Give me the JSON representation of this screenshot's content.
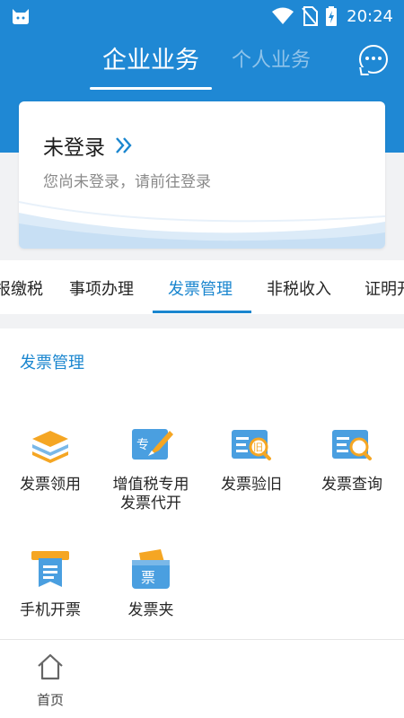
{
  "status_bar": {
    "time": "20:24",
    "icons": [
      "cat-app-icon",
      "wifi-icon",
      "no-sim-icon",
      "battery-charging-icon"
    ]
  },
  "header": {
    "tabs": [
      {
        "label": "企业业务",
        "active": true
      },
      {
        "label": "个人业务",
        "active": false
      }
    ],
    "chat_icon": "chat-bubble-icon",
    "background_color": "#1f88d4"
  },
  "login_card": {
    "title": "未登录",
    "subtitle": "您尚未登录，请前往登录",
    "arrow_icon": "double-chevron-right-icon"
  },
  "category_tabs": [
    {
      "label": "报缴税",
      "active": false
    },
    {
      "label": "事项办理",
      "active": false
    },
    {
      "label": "发票管理",
      "active": true
    },
    {
      "label": "非税收入",
      "active": false
    },
    {
      "label": "证明开",
      "active": false
    }
  ],
  "section": {
    "title": "发票管理",
    "items": [
      {
        "label": "发票领用",
        "icon": "layers-icon"
      },
      {
        "label_line1": "增值税专用",
        "label_line2": "发票代开",
        "icon": "special-invoice-pen-icon",
        "icon_text": "专"
      },
      {
        "label": "发票验旧",
        "icon": "invoice-search-old-icon",
        "icon_text": "旧"
      },
      {
        "label": "发票查询",
        "icon": "invoice-search-icon"
      },
      {
        "label": "手机开票",
        "icon": "printer-receipt-icon"
      },
      {
        "label": "发票夹",
        "icon": "invoice-folder-icon",
        "icon_text": "票"
      }
    ]
  },
  "bottom_nav": {
    "items": [
      {
        "label": "首页",
        "icon": "home-icon"
      }
    ]
  },
  "colors": {
    "accent": "#1a86cf",
    "orange": "#f5a623"
  }
}
